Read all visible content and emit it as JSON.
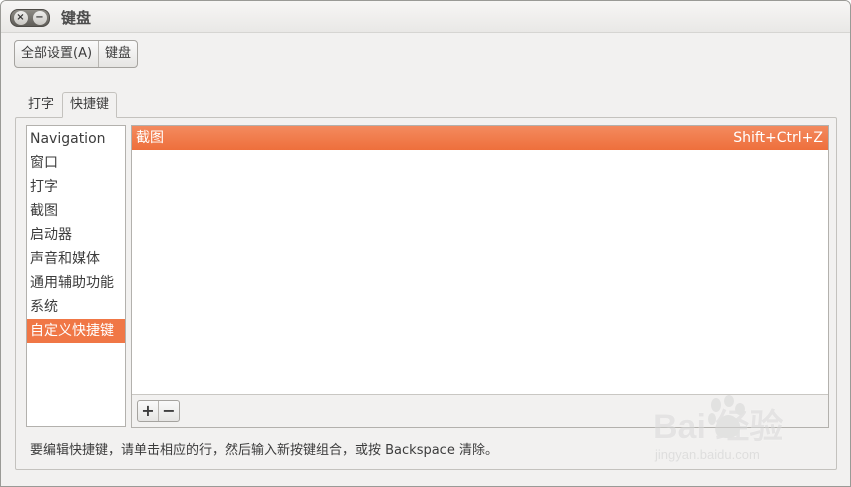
{
  "window": {
    "title": "键盘",
    "close_icon": "×",
    "minimize_icon": "−"
  },
  "breadcrumb": {
    "items": [
      "全部设置(A)",
      "键盘"
    ]
  },
  "tabs": [
    {
      "label": "打字",
      "active": false
    },
    {
      "label": "快捷键",
      "active": true
    }
  ],
  "categories": {
    "items": [
      "Navigation",
      "窗口",
      "打字",
      "截图",
      "启动器",
      "声音和媒体",
      "通用辅助功能",
      "系统",
      "自定义快捷键"
    ],
    "selected": "自定义快捷键"
  },
  "shortcuts": {
    "rows": [
      {
        "action": "截图",
        "binding": "Shift+Ctrl+Z",
        "selected": true
      }
    ]
  },
  "toolbar": {
    "add_label": "+",
    "remove_label": "−"
  },
  "hint": "要编辑快捷键，请单击相应的行，然后输入新按键组合，或按 Backspace 清除。",
  "watermark": {
    "brand": "Bai  经验",
    "url": "jingyan.baidu.com"
  },
  "colors": {
    "accent": "#f07746",
    "window_bg": "#f2f1f0"
  }
}
